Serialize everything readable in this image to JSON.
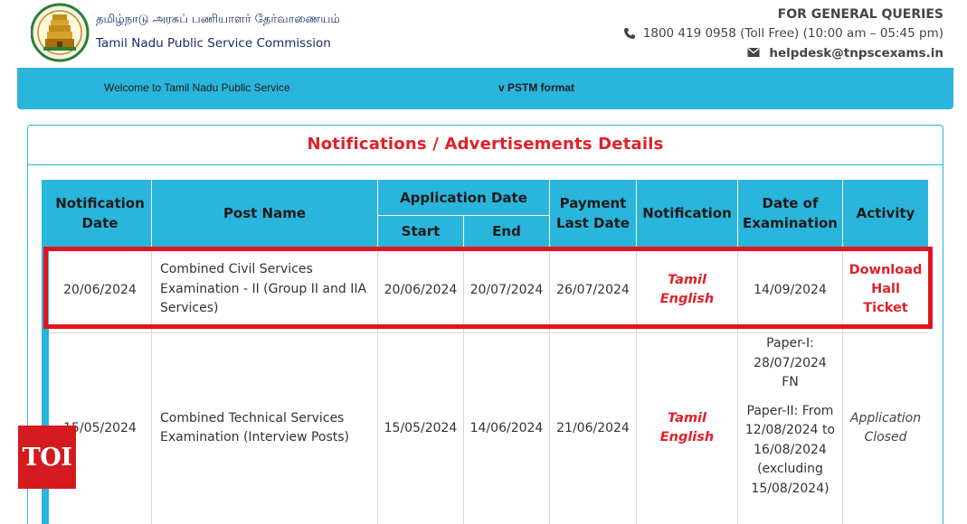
{
  "header": {
    "org_tamil": "தமிழ்நாடு அரசுப் பணியாளர் தேர்வாணையம்",
    "org_english": "Tamil Nadu Public Service Commission",
    "queries_title": "FOR GENERAL QUERIES",
    "phone": "1800 419 0958 (Toll Free)  (10:00 am – 05:45 pm)",
    "email": "helpdesk@tnpscexams.in",
    "phone_icon": "phone-icon",
    "mail_icon": "mail-icon"
  },
  "marquee": {
    "left_text": "Welcome to Tamil Nadu Public Service",
    "right_text": "v PSTM format"
  },
  "panel": {
    "title": "Notifications / Advertisements Details"
  },
  "table": {
    "headers": {
      "notification_date": "Notification Date",
      "post_name": "Post Name",
      "application_date": "Application Date",
      "start": "Start",
      "end": "End",
      "payment_last_date": "Payment Last Date",
      "notification": "Notification",
      "date_of_examination": "Date of Examination",
      "activity": "Activity"
    },
    "rows": [
      {
        "notification_date": "20/06/2024",
        "post_name": "Combined Civil Services Examination - II (Group II and IIA Services)",
        "start": "20/06/2024",
        "end": "20/07/2024",
        "payment_last_date": "26/07/2024",
        "notification_tamil": "Tamil",
        "notification_english": "English",
        "exam_date": "14/09/2024",
        "activity_line1": "Download",
        "activity_line2": "Hall Ticket"
      },
      {
        "notification_date": "15/05/2024",
        "post_name": "Combined Technical Services Examination (Interview Posts)",
        "start": "15/05/2024",
        "end": "14/06/2024",
        "payment_last_date": "21/06/2024",
        "notification_tamil": "Tamil",
        "notification_english": "English",
        "exam_paper1_label": "Paper-I:",
        "exam_paper1_date": "28/07/2024",
        "exam_paper1_session": "FN",
        "exam_paper2_label": "Paper-II: From",
        "exam_paper2_from": "12/08/2024 to",
        "exam_paper2_to": "16/08/2024",
        "exam_paper2_excl": "(excluding",
        "exam_paper2_excl_date": "15/08/2024)",
        "activity_line1": "Application",
        "activity_line2": "Closed"
      }
    ]
  },
  "watermark": {
    "text": "TOI"
  },
  "colors": {
    "accent": "#2ab5dc",
    "title_red": "#e0202a",
    "highlight_red": "#e2141f",
    "toi_red": "#d41a1f"
  }
}
